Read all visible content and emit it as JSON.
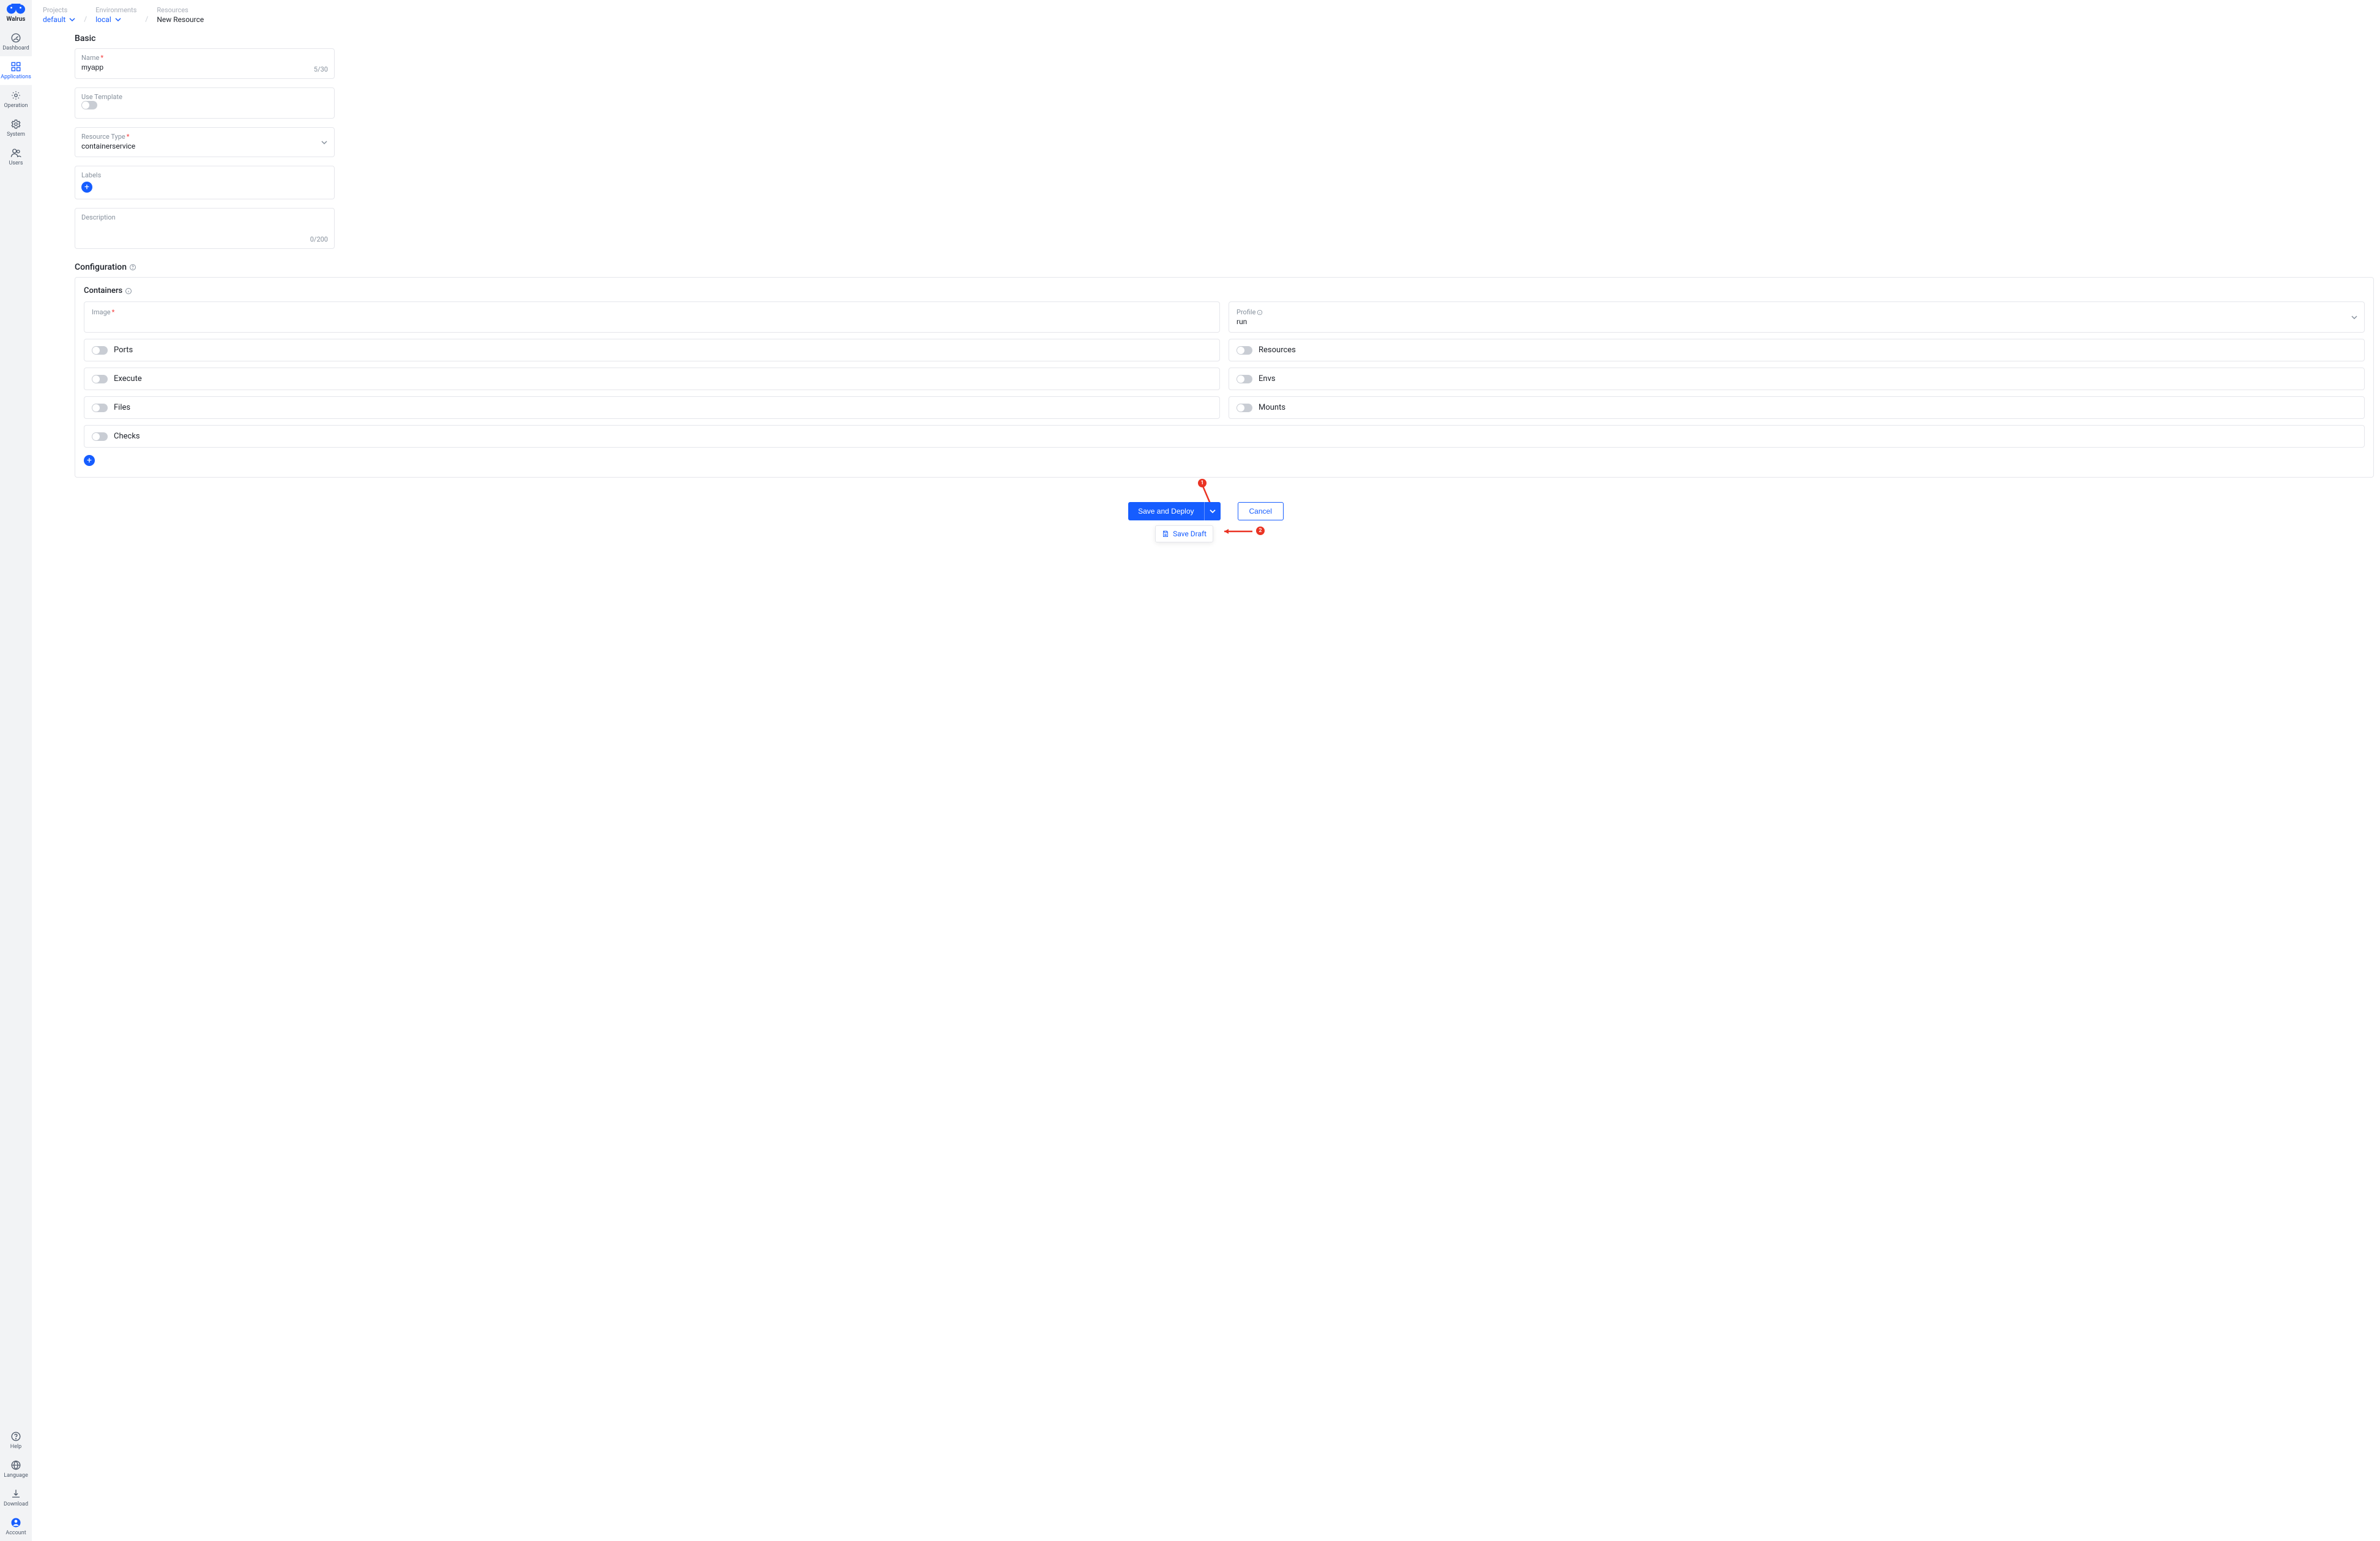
{
  "brand": {
    "name": "Walrus"
  },
  "sidebar": {
    "items": [
      {
        "label": "Dashboard"
      },
      {
        "label": "Applications"
      },
      {
        "label": "Operation"
      },
      {
        "label": "System"
      },
      {
        "label": "Users"
      }
    ],
    "footer": [
      {
        "label": "Help"
      },
      {
        "label": "Language"
      },
      {
        "label": "Download"
      },
      {
        "label": "Account"
      }
    ]
  },
  "breadcrumb": {
    "projects_label": "Projects",
    "projects_value": "default",
    "envs_label": "Environments",
    "envs_value": "local",
    "resources_label": "Resources",
    "resources_value": "New Resource"
  },
  "basic": {
    "title": "Basic",
    "name_label": "Name",
    "name_value": "myapp",
    "name_counter": "5/30",
    "use_template_label": "Use Template",
    "resource_type_label": "Resource Type",
    "resource_type_value": "containerservice",
    "labels_label": "Labels",
    "description_label": "Description",
    "description_counter": "0/200"
  },
  "configuration": {
    "title": "Configuration",
    "subtitle": "Containers",
    "image_label": "Image",
    "profile_label": "Profile",
    "profile_value": "run",
    "ports_label": "Ports",
    "resources_label": "Resources",
    "execute_label": "Execute",
    "envs_label": "Envs",
    "files_label": "Files",
    "mounts_label": "Mounts",
    "checks_label": "Checks"
  },
  "footer": {
    "save_deploy": "Save and Deploy",
    "cancel": "Cancel",
    "save_draft": "Save Draft"
  },
  "annotations": {
    "one": "1",
    "two": "2"
  }
}
